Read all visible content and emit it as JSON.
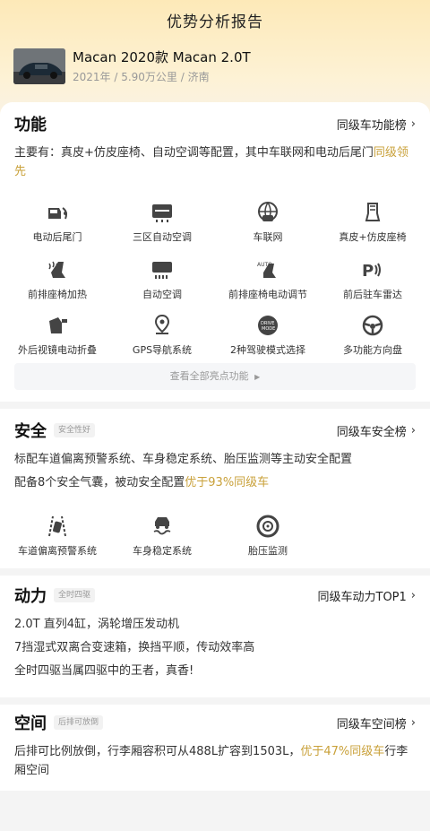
{
  "header": {
    "title": "优势分析报告"
  },
  "car": {
    "name": "Macan 2020款 Macan 2.0T",
    "meta": "2021年 / 5.90万公里 / 济南"
  },
  "features": {
    "title": "功能",
    "rank": "同级车功能榜",
    "desc_main": "主要有：真皮+仿皮座椅、自动空调等配置，其中车联网和电动后尾门",
    "desc_hl": "同级领先",
    "items": [
      {
        "label": "电动后尾门",
        "icon": "power-tailgate-icon"
      },
      {
        "label": "三区自动空调",
        "icon": "tri-zone-ac-icon"
      },
      {
        "label": "车联网",
        "icon": "connected-car-icon"
      },
      {
        "label": "真皮+仿皮座椅",
        "icon": "leather-seat-icon"
      },
      {
        "label": "前排座椅加热",
        "icon": "seat-heating-icon"
      },
      {
        "label": "自动空调",
        "icon": "auto-ac-icon"
      },
      {
        "label": "前排座椅电动调节",
        "icon": "power-seat-icon"
      },
      {
        "label": "前后驻车雷达",
        "icon": "parking-radar-icon"
      },
      {
        "label": "外后视镜电动折叠",
        "icon": "mirror-fold-icon"
      },
      {
        "label": "GPS导航系统",
        "icon": "gps-icon"
      },
      {
        "label": "2种驾驶模式选择",
        "icon": "drive-mode-icon"
      },
      {
        "label": "多功能方向盘",
        "icon": "steering-wheel-icon"
      }
    ],
    "view_all": "查看全部亮点功能"
  },
  "safety": {
    "title": "安全",
    "tag": "安全性好",
    "rank": "同级车安全榜",
    "line1": "标配车道偏离预警系统、车身稳定系统、胎压监测等主动安全配置",
    "line2_main": "配备8个安全气囊，被动安全配置",
    "line2_hl": "优于93%同级车",
    "items": [
      {
        "label": "车道偏离预警系统",
        "icon": "lane-departure-icon"
      },
      {
        "label": "车身稳定系统",
        "icon": "stability-control-icon"
      },
      {
        "label": "胎压监测",
        "icon": "tire-pressure-icon"
      }
    ]
  },
  "power": {
    "title": "动力",
    "tag": "全时四驱",
    "rank": "同级车动力TOP1",
    "lines": [
      "2.0T 直列4缸，涡轮增压发动机",
      "7挡湿式双离合变速箱，换挡平顺，传动效率高",
      "全时四驱当属四驱中的王者，真香!"
    ]
  },
  "space": {
    "title": "空间",
    "tag": "后排可放倒",
    "rank": "同级车空间榜",
    "text_main": "后排可比例放倒，行李厢容积可从488L扩容到1503L，",
    "text_hl": "优于47%同级车",
    "text_tail": "行李厢空间"
  },
  "colors": {
    "accent": "#c9a13a",
    "icon": "#444444"
  }
}
